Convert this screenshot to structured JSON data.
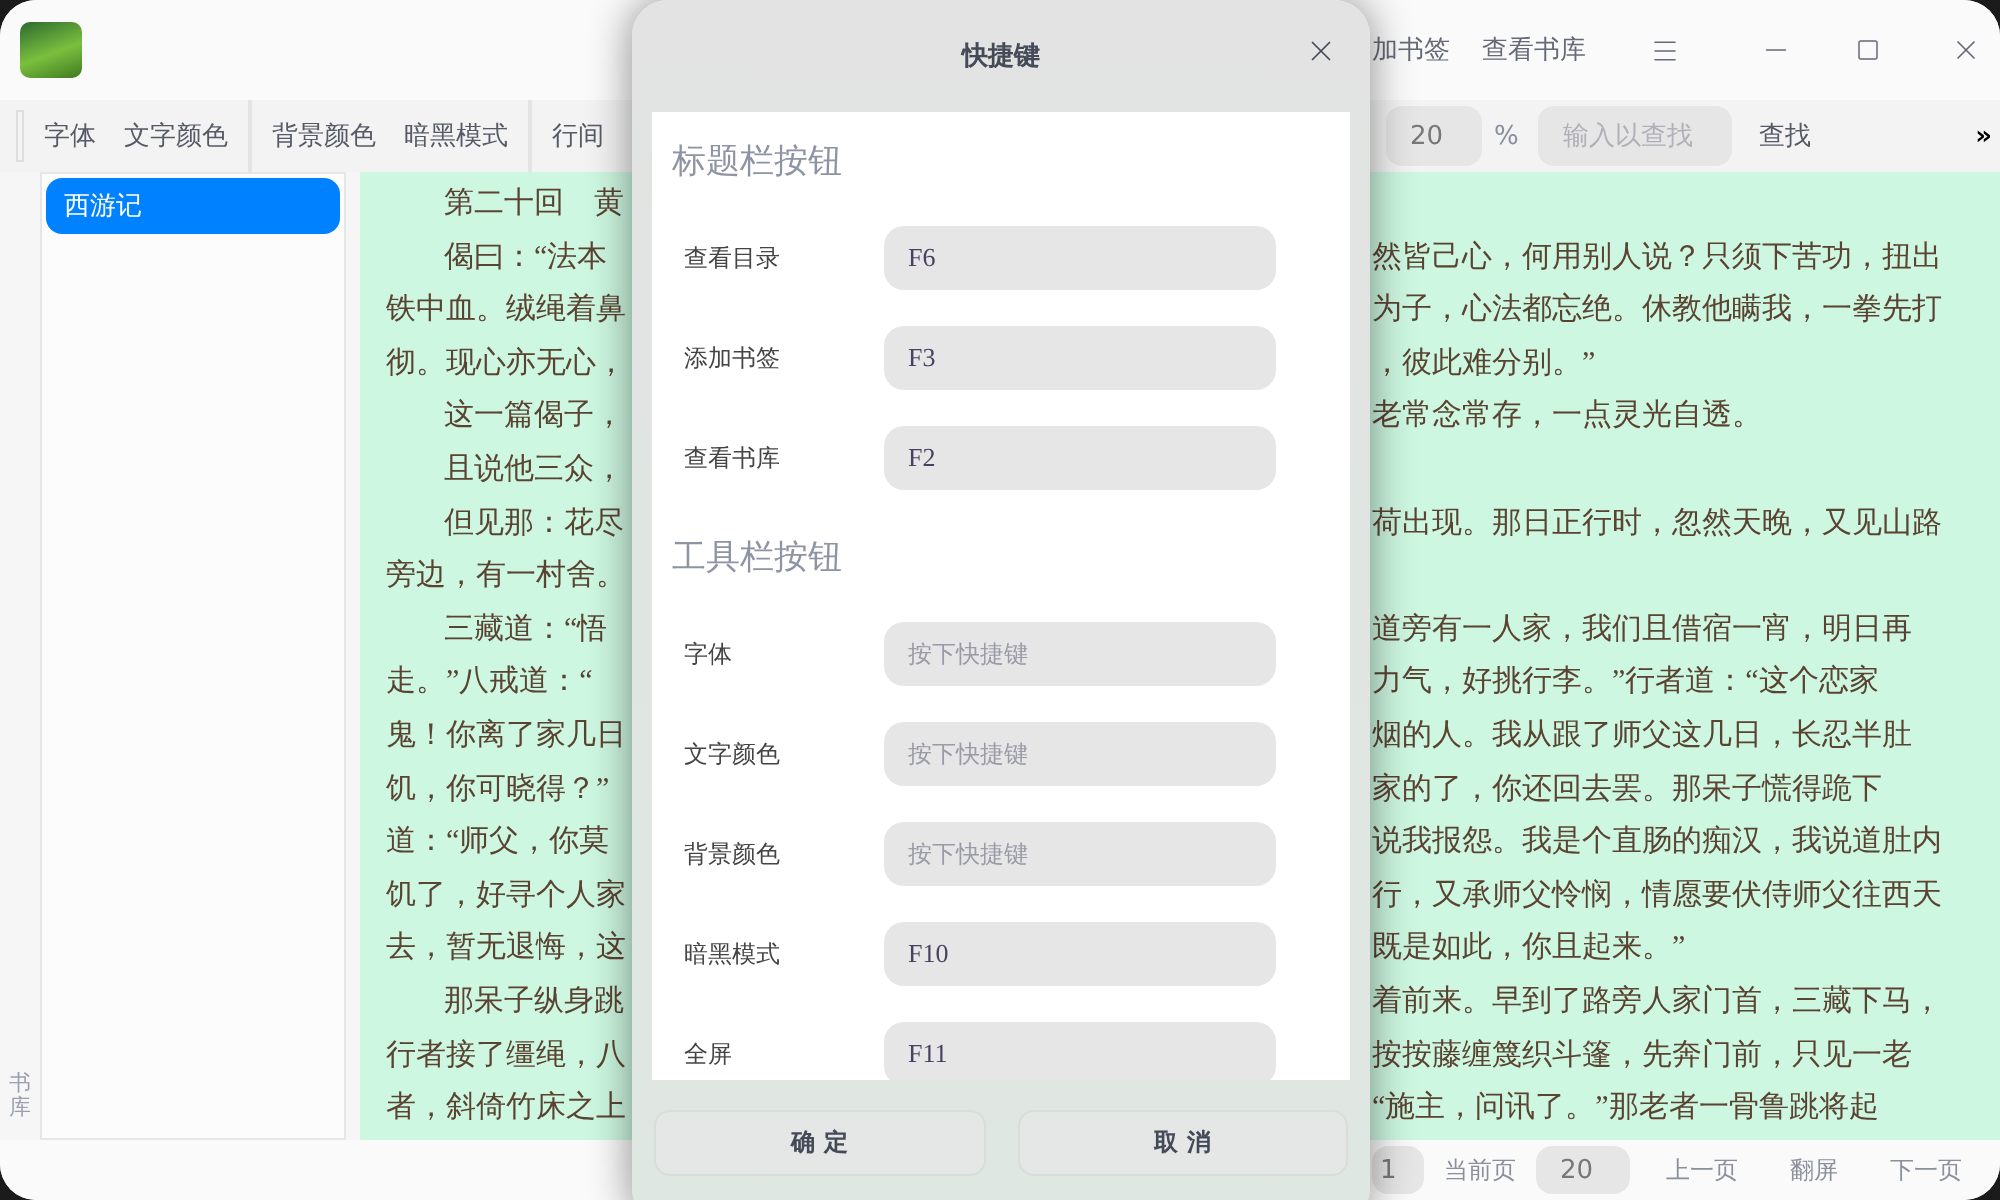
{
  "title_bar": {
    "buttons": [
      "加书签",
      "查看书库"
    ]
  },
  "toolbar": {
    "left_items": [
      {
        "kind": "button",
        "label": "字体"
      },
      {
        "kind": "button",
        "label": "文字颜色"
      },
      {
        "kind": "separator"
      },
      {
        "kind": "button",
        "label": "背景颜色"
      },
      {
        "kind": "button",
        "label": "暗黑模式"
      },
      {
        "kind": "separator"
      },
      {
        "kind": "button",
        "label": "行间"
      }
    ],
    "zoom_value": "20",
    "zoom_unit": "%",
    "search": {
      "placeholder": "输入以查找"
    },
    "search_button": "查找",
    "overflow": "»"
  },
  "sidebar": {
    "tab": "书库",
    "books": [
      {
        "title": "西游记",
        "selected": true
      }
    ]
  },
  "reader": {
    "lines": [
      {
        "left": "第二十回　黄",
        "indent": true
      },
      {
        "left": "偈曰：“法本",
        "right": "然皆己心，何用别人说？只须下苦功，扭出",
        "indent": true
      },
      {
        "left": "铁中血。绒绳着鼻",
        "right": "为子，心法都忘绝。休教他瞒我，一拳先打",
        "indent": false
      },
      {
        "left": "彻。现心亦无心，",
        "right": "，彼此难分别。”",
        "indent": false
      },
      {
        "left": "这一篇偈子，",
        "right": "老常念常存，一点灵光自透。",
        "indent": true
      },
      {
        "left": "且说他三众，",
        "indent": true
      },
      {
        "left": "但见那：花尽",
        "right": "荷出现。那日正行时，忽然天晚，又见山路",
        "indent": true
      },
      {
        "left": "旁边，有一村舍。",
        "indent": false
      },
      {
        "left": "三藏道：“悟",
        "right": "道旁有一人家，我们且借宿一宵，明日再",
        "indent": true
      },
      {
        "left": "走。”八戒道：“",
        "right": "力气，好挑行李。”行者道：“这个恋家",
        "indent": false
      },
      {
        "left": "鬼！你离了家几日",
        "right": "烟的人。我从跟了师父这几日，长忍半肚",
        "indent": false
      },
      {
        "left": "饥，你可晓得？”",
        "right": "家的了，你还回去罢。那呆子慌得跪下",
        "indent": false
      },
      {
        "left": "道：“师父，你莫",
        "right": "说我报怨。我是个直肠的痴汉，我说道肚内",
        "indent": false
      },
      {
        "left": "饥了，好寻个人家",
        "right": "行，又承师父怜悯，情愿要伏侍师父往西天",
        "indent": false
      },
      {
        "left": "去，暂无退悔，这",
        "right": "既是如此，你且起来。”",
        "indent": false
      },
      {
        "left": "那呆子纵身跳",
        "right": "着前来。早到了路旁人家门首，三藏下马，",
        "indent": true
      },
      {
        "left": "行者接了缰绳，八",
        "right": "按按藤缠篾织斗篷，先奔门前，只见一老",
        "indent": false
      },
      {
        "left": "者，斜倚竹床之上",
        "right": "“施主，问讯了。”那老者一骨鲁跳将起",
        "indent": false
      }
    ]
  },
  "page_bar": {
    "page_value": "1",
    "page_label": "当前页",
    "size_value": "20",
    "buttons": [
      "上一页",
      "翻屏",
      "下一页"
    ]
  },
  "dialog": {
    "title": "快捷键",
    "sections": [
      {
        "title": "标题栏按钮",
        "rows": [
          {
            "label": "查看目录",
            "value": "F6"
          },
          {
            "label": "添加书签",
            "value": "F3"
          },
          {
            "label": "查看书库",
            "value": "F2"
          }
        ]
      },
      {
        "title": "工具栏按钮",
        "rows": [
          {
            "label": "字体",
            "placeholder": "按下快捷键"
          },
          {
            "label": "文字颜色",
            "placeholder": "按下快捷键"
          },
          {
            "label": "背景颜色",
            "placeholder": "按下快捷键"
          },
          {
            "label": "暗黑模式",
            "value": "F10"
          },
          {
            "label": "全屏",
            "value": "F11"
          }
        ]
      }
    ],
    "buttons": [
      "确 定",
      "取 消"
    ]
  }
}
